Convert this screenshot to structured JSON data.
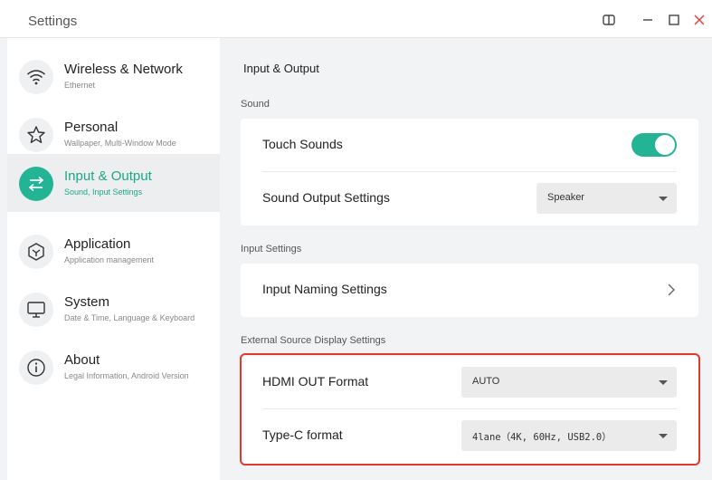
{
  "window": {
    "title": "Settings",
    "controls": [
      "split-view-icon",
      "minimize-icon",
      "maximize-icon",
      "close-icon"
    ]
  },
  "sidebar": {
    "items": [
      {
        "title": "Wireless & Network",
        "subtitle": "Ethernet",
        "icon": "wifi-icon",
        "active": false
      },
      {
        "title": "Personal",
        "subtitle": "Wallpaper, Multi-Window Mode",
        "icon": "star-icon",
        "active": false
      },
      {
        "title": "Input & Output",
        "subtitle": "Sound, Input Settings",
        "icon": "swap-arrows-icon",
        "active": true
      },
      {
        "title": "Application",
        "subtitle": "Application management",
        "icon": "cube-icon",
        "active": false
      },
      {
        "title": "System",
        "subtitle": "Date & Time, Language & Keyboard",
        "icon": "monitor-icon",
        "active": false
      },
      {
        "title": "About",
        "subtitle": "Legal Information, Android Version",
        "icon": "info-icon",
        "active": false
      }
    ]
  },
  "main": {
    "title": "Input & Output",
    "sound": {
      "label": "Sound",
      "touch_sounds": {
        "label": "Touch Sounds",
        "enabled": true
      },
      "output": {
        "label": "Sound Output Settings",
        "value": "Speaker"
      }
    },
    "input": {
      "label": "Input Settings",
      "naming": {
        "label": "Input Naming Settings"
      }
    },
    "external": {
      "label": "External Source Display Settings",
      "hdmi": {
        "label": "HDMI OUT Format",
        "value": "AUTO"
      },
      "typec": {
        "label": "Type-C format",
        "value": "4lane（4K, 60Hz, USB2.0）"
      }
    }
  },
  "colors": {
    "accent": "#23b495",
    "highlight_border": "#e23a2a",
    "close": "#e0473a"
  }
}
